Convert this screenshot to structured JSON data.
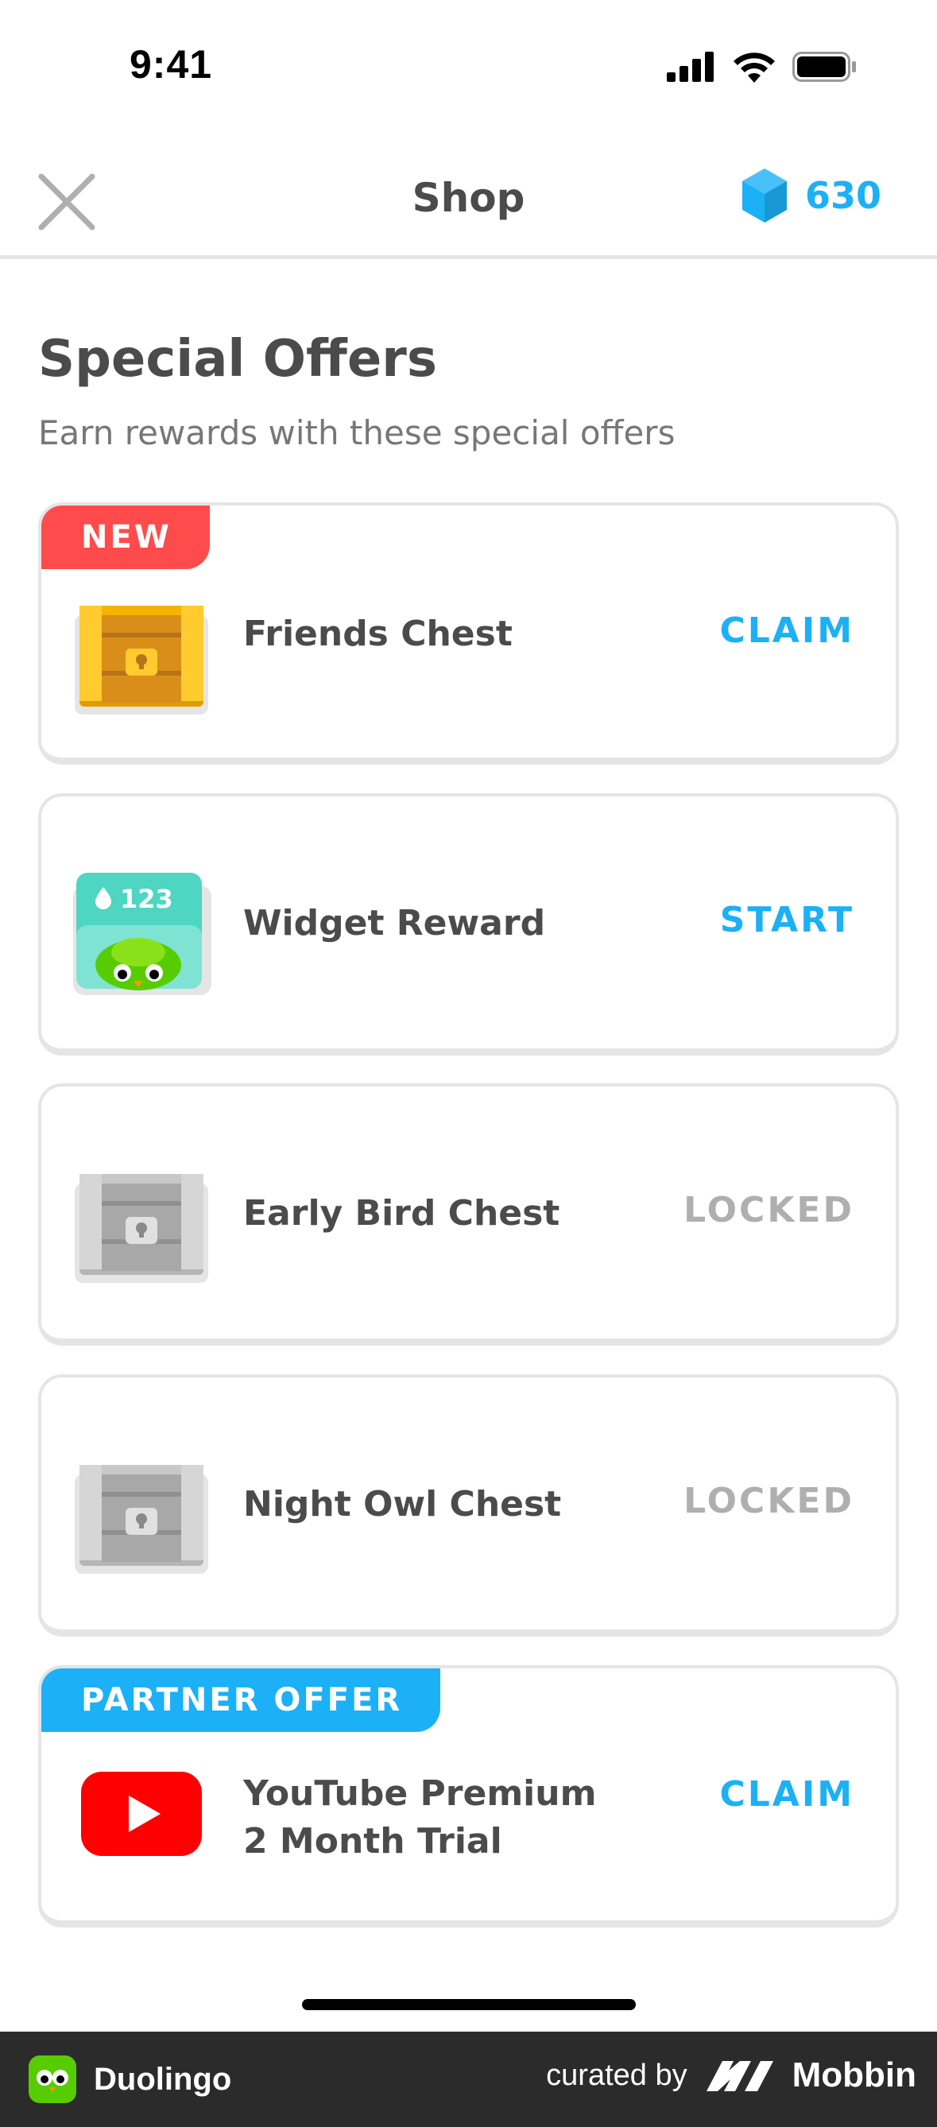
{
  "status_bar": {
    "time": "9:41"
  },
  "header": {
    "title": "Shop",
    "gems": "630"
  },
  "section": {
    "title": "Special Offers",
    "subtitle": "Earn rewards with these special offers"
  },
  "offers": [
    {
      "badge": "NEW",
      "label": "Friends Chest",
      "action": "CLAIM",
      "icon": "gold-chest-icon"
    },
    {
      "label": "Widget Reward",
      "action": "START",
      "icon": "widget-icon",
      "widget_count": "123"
    },
    {
      "label": "Early Bird Chest",
      "action": "LOCKED",
      "icon": "locked-chest-icon"
    },
    {
      "label": "Night Owl Chest",
      "action": "LOCKED",
      "icon": "locked-chest-icon"
    },
    {
      "badge": "PARTNER OFFER",
      "label_line1": "YouTube Premium",
      "label_line2": "2 Month Trial",
      "action": "CLAIM",
      "icon": "youtube-icon"
    }
  ],
  "colors": {
    "accent": "#1cb0f6",
    "new_badge": "#ff4b4b",
    "locked": "#afafaf"
  },
  "footer": {
    "app_name": "Duolingo",
    "curated_by": "curated by",
    "brand": "Mobbin"
  }
}
